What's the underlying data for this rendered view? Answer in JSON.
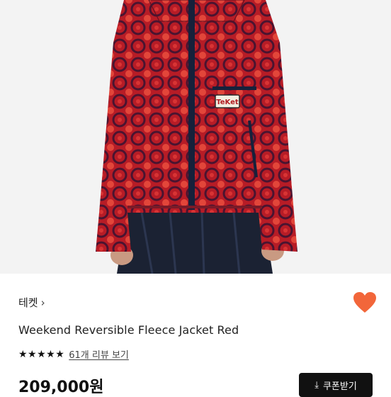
{
  "product": {
    "brand": "테켓",
    "brand_chevron": "›",
    "name": "Weekend Reversible Fleece Jacket Red",
    "rating_stars": "★★★★★",
    "review_text": "61개 리뷰 보기",
    "price": "209,000원",
    "patch_text": "TeKet"
  },
  "actions": {
    "coupon_icon": "download-icon",
    "coupon_icon_glyph": "⤓",
    "coupon_label": "쿠폰받기",
    "wishlist_icon": "heart-icon"
  },
  "colors": {
    "accent_heart": "#f2663a",
    "jacket_red": "#c8202a",
    "jacket_dark": "#5a1020",
    "coupon_bg": "#111111"
  }
}
